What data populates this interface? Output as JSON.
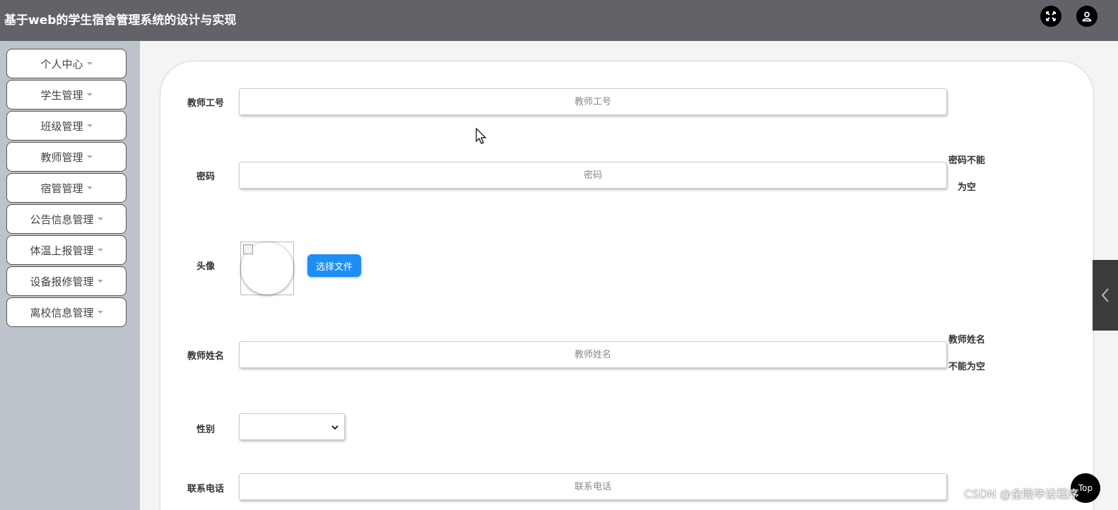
{
  "app": {
    "title": "基于web的学生宿舍管理系统的设计与实现"
  },
  "header": {
    "fullscreen_icon": "expand-icon",
    "user_icon": "user-icon"
  },
  "sidebar": {
    "items": [
      {
        "label": "个人中心"
      },
      {
        "label": "学生管理"
      },
      {
        "label": "班级管理"
      },
      {
        "label": "教师管理"
      },
      {
        "label": "宿管管理"
      },
      {
        "label": "公告信息管理"
      },
      {
        "label": "体温上报管理"
      },
      {
        "label": "设备报修管理"
      },
      {
        "label": "离校信息管理"
      }
    ]
  },
  "form": {
    "teacher_id": {
      "label": "教师工号",
      "placeholder": "教师工号",
      "value": ""
    },
    "password": {
      "label": "密码",
      "placeholder": "密码",
      "value": "",
      "error_line1": "密码不能",
      "error_line2": "为空"
    },
    "avatar": {
      "label": "头像",
      "button": "选择文件"
    },
    "teacher_name": {
      "label": "教师姓名",
      "placeholder": "教师姓名",
      "value": "",
      "error_line1": "教师姓名",
      "error_line2": "不能为空"
    },
    "gender": {
      "label": "性别",
      "value": ""
    },
    "phone": {
      "label": "联系电话",
      "placeholder": "联系电话",
      "value": ""
    }
  },
  "floating": {
    "top_button": "Top",
    "collapse_icon": "chevron-left-icon"
  },
  "watermark": "CSDN @金陵毕设程序",
  "colors": {
    "header": "#636269",
    "sidebar": "#bcc3ca",
    "primary_button": "#1e8ef7"
  }
}
